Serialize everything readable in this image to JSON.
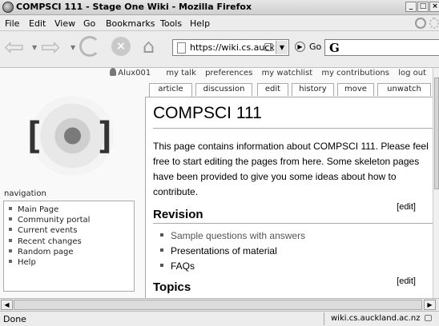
{
  "window": {
    "title": "COMPSCI 111 - Stage One Wiki - Mozilla Firefox",
    "buttons": {
      "minimize": "_",
      "maximize": "□",
      "close": "×"
    }
  },
  "menu": [
    "File",
    "Edit",
    "View",
    "Go",
    "Bookmarks",
    "Tools",
    "Help"
  ],
  "toolbar": {
    "url": "https://wiki.cs.auck",
    "go_label": "Go",
    "search_engine_glyph": "G"
  },
  "personal_links": [
    "Alux001",
    "my talk",
    "preferences",
    "my watchlist",
    "my contributions",
    "log out"
  ],
  "tabs": [
    "article",
    "discussion",
    "edit",
    "history",
    "move",
    "unwatch"
  ],
  "sidebar": {
    "nav_heading": "navigation",
    "items": [
      "Main Page",
      "Community portal",
      "Current events",
      "Recent changes",
      "Random page",
      "Help"
    ]
  },
  "article": {
    "title": "COMPSCI 111",
    "intro": "This page contains information about COMPSCI 111. Please feel free to start editing the pages from here. Some skeleton pages have been provided to give you some ideas about how to contribute.",
    "sections": [
      {
        "heading": "Revision",
        "edit": "[edit]",
        "items": [
          "Sample questions with answers",
          "Presentations of material",
          "FAQs"
        ]
      },
      {
        "heading": "Topics",
        "edit": "[edit]"
      }
    ]
  },
  "status": {
    "text": "Done",
    "domain": "wiki.cs.auckland.ac.nz"
  }
}
